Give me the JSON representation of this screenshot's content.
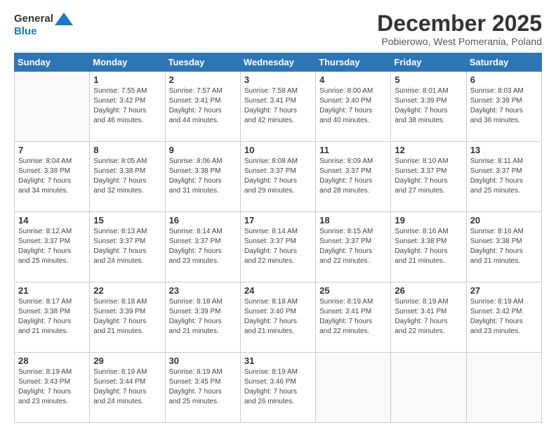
{
  "header": {
    "logo_line1": "General",
    "logo_line2": "Blue",
    "month": "December 2025",
    "location": "Pobierowo, West Pomerania, Poland"
  },
  "days_of_week": [
    "Sunday",
    "Monday",
    "Tuesday",
    "Wednesday",
    "Thursday",
    "Friday",
    "Saturday"
  ],
  "weeks": [
    [
      {
        "day": "",
        "info": ""
      },
      {
        "day": "1",
        "info": "Sunrise: 7:55 AM\nSunset: 3:42 PM\nDaylight: 7 hours\nand 46 minutes."
      },
      {
        "day": "2",
        "info": "Sunrise: 7:57 AM\nSunset: 3:41 PM\nDaylight: 7 hours\nand 44 minutes."
      },
      {
        "day": "3",
        "info": "Sunrise: 7:58 AM\nSunset: 3:41 PM\nDaylight: 7 hours\nand 42 minutes."
      },
      {
        "day": "4",
        "info": "Sunrise: 8:00 AM\nSunset: 3:40 PM\nDaylight: 7 hours\nand 40 minutes."
      },
      {
        "day": "5",
        "info": "Sunrise: 8:01 AM\nSunset: 3:39 PM\nDaylight: 7 hours\nand 38 minutes."
      },
      {
        "day": "6",
        "info": "Sunrise: 8:03 AM\nSunset: 3:39 PM\nDaylight: 7 hours\nand 36 minutes."
      }
    ],
    [
      {
        "day": "7",
        "info": "Sunrise: 8:04 AM\nSunset: 3:38 PM\nDaylight: 7 hours\nand 34 minutes."
      },
      {
        "day": "8",
        "info": "Sunrise: 8:05 AM\nSunset: 3:38 PM\nDaylight: 7 hours\nand 32 minutes."
      },
      {
        "day": "9",
        "info": "Sunrise: 8:06 AM\nSunset: 3:38 PM\nDaylight: 7 hours\nand 31 minutes."
      },
      {
        "day": "10",
        "info": "Sunrise: 8:08 AM\nSunset: 3:37 PM\nDaylight: 7 hours\nand 29 minutes."
      },
      {
        "day": "11",
        "info": "Sunrise: 8:09 AM\nSunset: 3:37 PM\nDaylight: 7 hours\nand 28 minutes."
      },
      {
        "day": "12",
        "info": "Sunrise: 8:10 AM\nSunset: 3:37 PM\nDaylight: 7 hours\nand 27 minutes."
      },
      {
        "day": "13",
        "info": "Sunrise: 8:11 AM\nSunset: 3:37 PM\nDaylight: 7 hours\nand 25 minutes."
      }
    ],
    [
      {
        "day": "14",
        "info": "Sunrise: 8:12 AM\nSunset: 3:37 PM\nDaylight: 7 hours\nand 25 minutes."
      },
      {
        "day": "15",
        "info": "Sunrise: 8:13 AM\nSunset: 3:37 PM\nDaylight: 7 hours\nand 24 minutes."
      },
      {
        "day": "16",
        "info": "Sunrise: 8:14 AM\nSunset: 3:37 PM\nDaylight: 7 hours\nand 23 minutes."
      },
      {
        "day": "17",
        "info": "Sunrise: 8:14 AM\nSunset: 3:37 PM\nDaylight: 7 hours\nand 22 minutes."
      },
      {
        "day": "18",
        "info": "Sunrise: 8:15 AM\nSunset: 3:37 PM\nDaylight: 7 hours\nand 22 minutes."
      },
      {
        "day": "19",
        "info": "Sunrise: 8:16 AM\nSunset: 3:38 PM\nDaylight: 7 hours\nand 21 minutes."
      },
      {
        "day": "20",
        "info": "Sunrise: 8:16 AM\nSunset: 3:38 PM\nDaylight: 7 hours\nand 21 minutes."
      }
    ],
    [
      {
        "day": "21",
        "info": "Sunrise: 8:17 AM\nSunset: 3:38 PM\nDaylight: 7 hours\nand 21 minutes."
      },
      {
        "day": "22",
        "info": "Sunrise: 8:18 AM\nSunset: 3:39 PM\nDaylight: 7 hours\nand 21 minutes."
      },
      {
        "day": "23",
        "info": "Sunrise: 8:18 AM\nSunset: 3:39 PM\nDaylight: 7 hours\nand 21 minutes."
      },
      {
        "day": "24",
        "info": "Sunrise: 8:18 AM\nSunset: 3:40 PM\nDaylight: 7 hours\nand 21 minutes."
      },
      {
        "day": "25",
        "info": "Sunrise: 8:19 AM\nSunset: 3:41 PM\nDaylight: 7 hours\nand 22 minutes."
      },
      {
        "day": "26",
        "info": "Sunrise: 8:19 AM\nSunset: 3:41 PM\nDaylight: 7 hours\nand 22 minutes."
      },
      {
        "day": "27",
        "info": "Sunrise: 8:19 AM\nSunset: 3:42 PM\nDaylight: 7 hours\nand 23 minutes."
      }
    ],
    [
      {
        "day": "28",
        "info": "Sunrise: 8:19 AM\nSunset: 3:43 PM\nDaylight: 7 hours\nand 23 minutes."
      },
      {
        "day": "29",
        "info": "Sunrise: 8:19 AM\nSunset: 3:44 PM\nDaylight: 7 hours\nand 24 minutes."
      },
      {
        "day": "30",
        "info": "Sunrise: 8:19 AM\nSunset: 3:45 PM\nDaylight: 7 hours\nand 25 minutes."
      },
      {
        "day": "31",
        "info": "Sunrise: 8:19 AM\nSunset: 3:46 PM\nDaylight: 7 hours\nand 26 minutes."
      },
      {
        "day": "",
        "info": ""
      },
      {
        "day": "",
        "info": ""
      },
      {
        "day": "",
        "info": ""
      }
    ]
  ]
}
